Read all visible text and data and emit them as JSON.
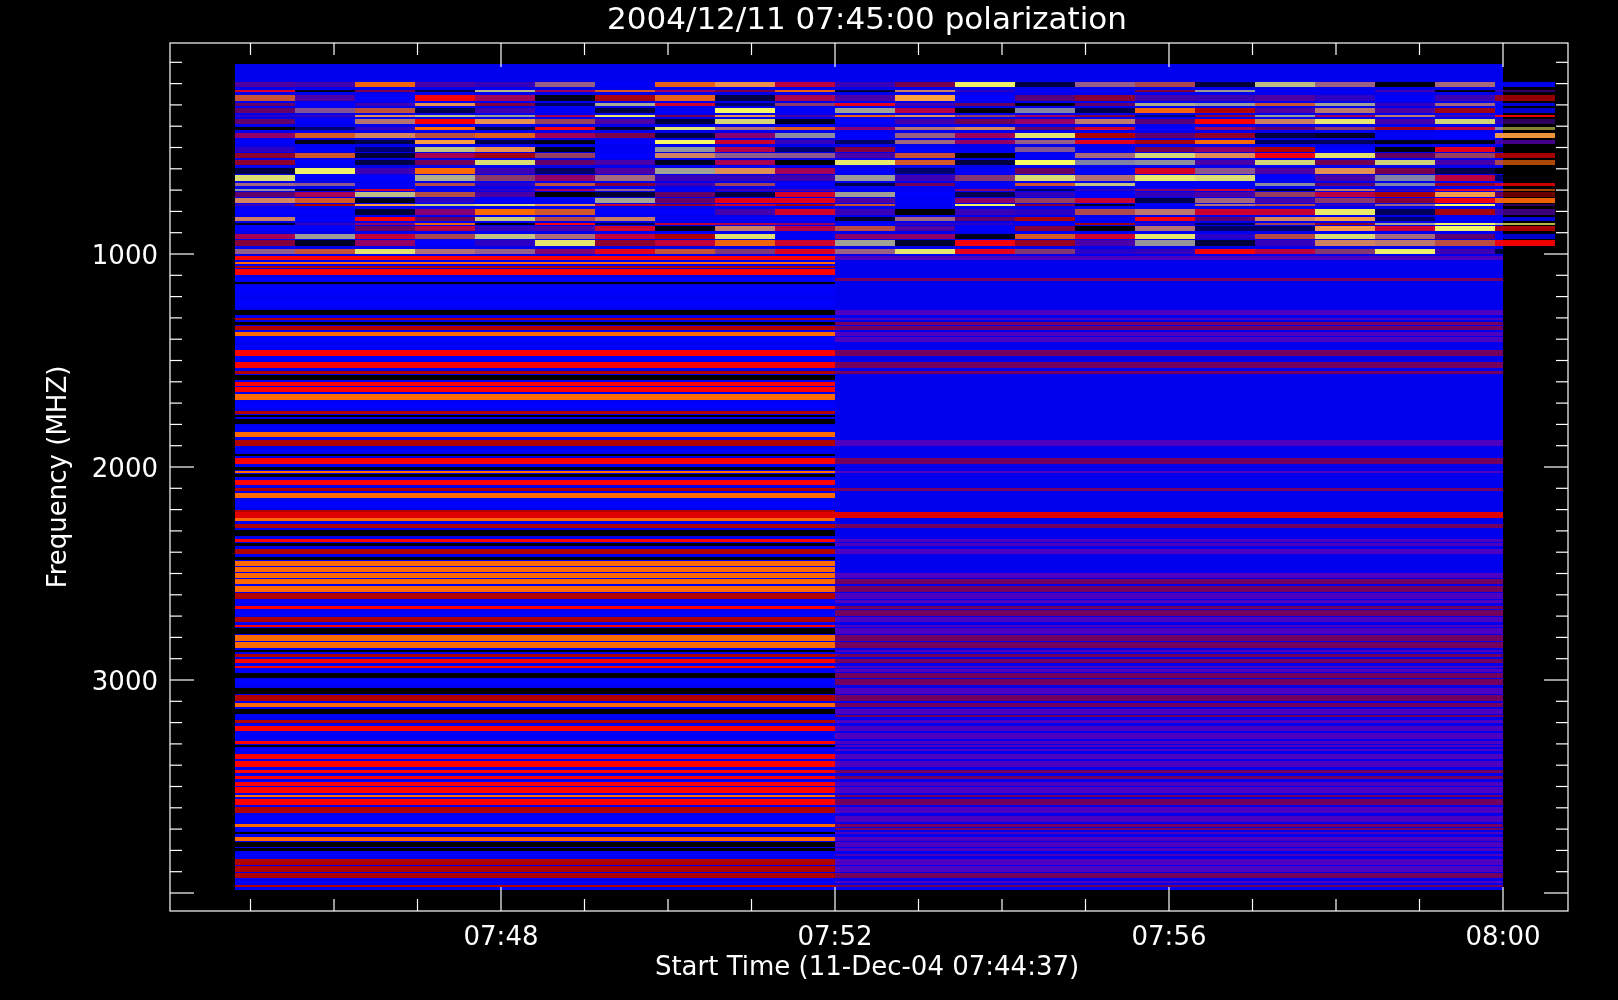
{
  "title": "2004/12/11 07:45:00 polarization",
  "y_axis": {
    "label": "Frequency (MHZ)",
    "tick_labels": [
      "1000",
      "2000",
      "3000"
    ]
  },
  "x_axis": {
    "label": "Start Time (11-Dec-04 07:44:37)",
    "tick_labels": [
      "07:48",
      "07:52",
      "07:56",
      "08:00"
    ]
  }
}
